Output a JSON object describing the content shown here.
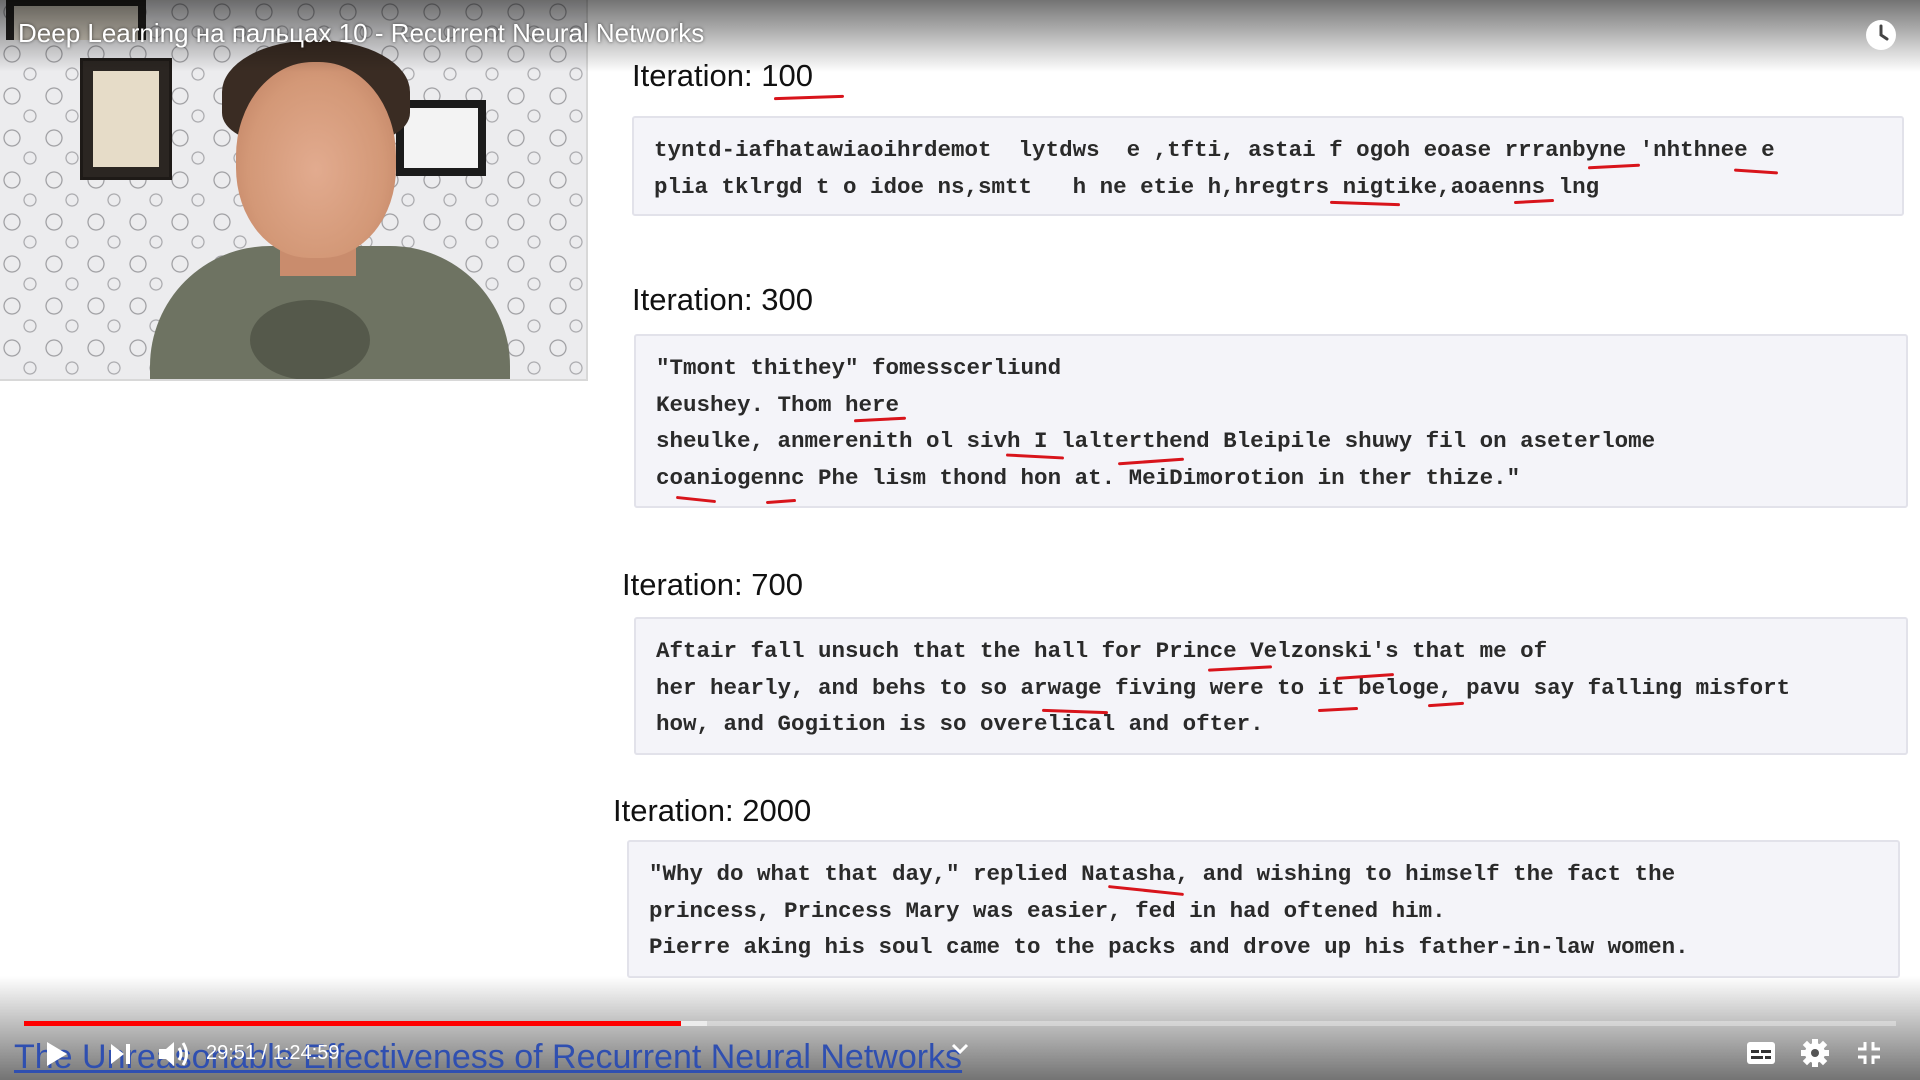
{
  "player": {
    "title": "Deep Learning на пальцах 10 - Recurrent Neural Networks",
    "current_time": "29:51",
    "duration": "1:24:59",
    "time_display": "29:51 / 1:24:59",
    "progress_fraction": 0.351,
    "buffered_fraction": 0.365,
    "accent_color": "#ff0000",
    "icons": {
      "top_right": "clock-icon",
      "controls_left": [
        "play-icon",
        "next-icon",
        "volume-icon"
      ],
      "controls_center": "chevron-down-icon",
      "controls_right": [
        "subtitles-icon",
        "settings-icon",
        "exit-fullscreen-icon"
      ]
    }
  },
  "slide": {
    "caption_link": "The Unreasonable Effectiveness of Recurrent Neural Networks",
    "iterations": [
      {
        "title": "Iteration: 100",
        "lines": [
          "tyntd-iafhatawiaoihrdemot  lytdws  e ,tfti, astai f ogoh eoase rrranbyne 'nhthnee e",
          "plia tklrgd t o idoe ns,smtt   h ne etie h,hregtrs nigtike,aoaenns lng"
        ]
      },
      {
        "title": "Iteration: 300",
        "lines": [
          "\"Tmont thithey\" fomesscerliund",
          "Keushey. Thom here",
          "sheulke, anmerenith ol sivh I lalterthend Bleipile shuwy fil on aseterlome",
          "coaniogennc Phe lism thond hon at. MeiDimorotion in ther thize.\""
        ]
      },
      {
        "title": "Iteration: 700",
        "lines": [
          "Aftair fall unsuch that the hall for Prince Velzonski's that me of",
          "her hearly, and behs to so arwage fiving were to it beloge, pavu say falling misfort",
          "how, and Gogition is so overelical and ofter."
        ]
      },
      {
        "title": "Iteration: 2000",
        "lines": [
          "\"Why do what that day,\" replied Natasha, and wishing to himself the fact the",
          "princess, Princess Mary was easier, fed in had oftened him.",
          "Pierre aking his soul came to the packs and drove up his father-in-law women."
        ]
      }
    ],
    "annotation_color": "#d8141b"
  }
}
